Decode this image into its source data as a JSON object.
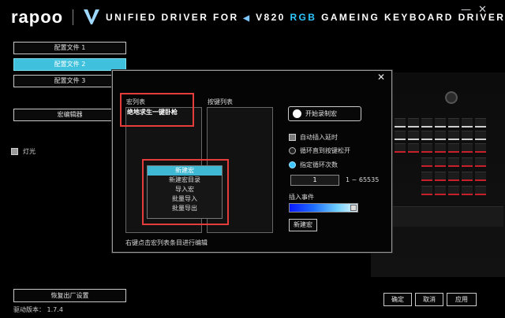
{
  "header": {
    "logo": "rapoo",
    "title_prefix": "UNIFIED DRIVER FOR",
    "title_model": "V820",
    "title_rgb": "RGB",
    "title_suffix": "GAMEING KEYBOARD DRIVER",
    "tri_left": "◀",
    "tri_right": "▶",
    "minimize": "—",
    "close": "✕"
  },
  "sidebar": {
    "profiles": [
      "配置文件 1",
      "配置文件 2",
      "配置文件 3"
    ],
    "active_profile_index": 1,
    "macro_editor": "宏编辑器",
    "lighting_label": "灯光"
  },
  "dialog": {
    "close": "✕",
    "macro_list_title": "宏列表",
    "selected_macro": "绝地求生一键卧枪",
    "key_list_title": "按键列表",
    "record_button": "开始录制宏",
    "auto_insert_delay": "自动插入延时",
    "loop_until_release": "循环直到按键松开",
    "specify_loop_count": "指定循环次数",
    "loop_count_value": "1",
    "loop_count_range": "1 ~ 65535",
    "insert_event": "插入事件",
    "new_macro_button": "新建宏",
    "hint": "右键点击宏列表条目进行编辑",
    "context_menu": [
      "新建宏",
      "新建宏目录",
      "导入宏",
      "批量导入",
      "批量导出"
    ],
    "context_menu_highlight_index": 0
  },
  "footer": {
    "restore_defaults": "恢复出厂设置",
    "ok": "确定",
    "cancel": "取消",
    "apply": "应用",
    "version_label": "驱动版本：",
    "version_value": "1.7.4"
  },
  "colors": {
    "accent": "#3fc0dc",
    "highlight_red": "#e53c3c"
  }
}
